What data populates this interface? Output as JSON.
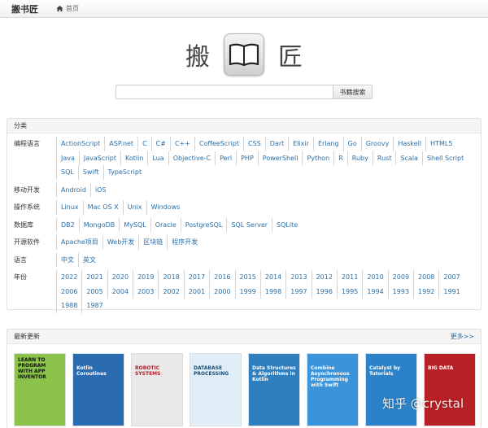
{
  "header": {
    "brand": "搬书匠",
    "home_label": "首页"
  },
  "hero": {
    "char_left": "搬",
    "char_right": "匠"
  },
  "search": {
    "placeholder": "",
    "button_label": "书籍搜索"
  },
  "categories": {
    "title": "分类",
    "rows": [
      {
        "label": "编程语言",
        "items": [
          "ActionScript",
          "ASP.net",
          "C",
          "C#",
          "C++",
          "CoffeeScript",
          "CSS",
          "Dart",
          "Elixir",
          "Erlang",
          "Go",
          "Groovy",
          "Haskell",
          "HTML5",
          "Java",
          "JavaScript",
          "Kotlin",
          "Lua",
          "Objective-C",
          "Perl",
          "PHP",
          "PowerShell",
          "Python",
          "R",
          "Ruby",
          "Rust",
          "Scala",
          "Shell Script",
          "SQL",
          "Swift",
          "TypeScript"
        ]
      },
      {
        "label": "移动开发",
        "items": [
          "Android",
          "iOS"
        ]
      },
      {
        "label": "操作系统",
        "items": [
          "Linux",
          "Mac OS X",
          "Unix",
          "Windows"
        ]
      },
      {
        "label": "数据库",
        "items": [
          "DB2",
          "MongoDB",
          "MySQL",
          "Oracle",
          "PostgreSQL",
          "SQL Server",
          "SQLite"
        ]
      },
      {
        "label": "开源软件",
        "items": [
          "Apache项目",
          "Web开发",
          "区块链",
          "程序开发"
        ]
      },
      {
        "label": "语言",
        "items": [
          "中文",
          "英文"
        ]
      },
      {
        "label": "年份",
        "items": [
          "2022",
          "2021",
          "2020",
          "2019",
          "2018",
          "2017",
          "2016",
          "2015",
          "2014",
          "2013",
          "2012",
          "2011",
          "2010",
          "2009",
          "2008",
          "2007",
          "2006",
          "2005",
          "2004",
          "2003",
          "2002",
          "2001",
          "2000",
          "1999",
          "1998",
          "1997",
          "1996",
          "1995",
          "1994",
          "1993",
          "1992",
          "1991",
          "1988",
          "1987"
        ]
      }
    ]
  },
  "latest": {
    "title": "最新更新",
    "more_label": "更多>>",
    "books": [
      {
        "title": "LEARN TO PROGRAM WITH APP INVENTOR",
        "bg": "#8bc34a",
        "fg": "#111111"
      },
      {
        "title": "Kotlin Coroutines",
        "bg": "#2b6cb0",
        "fg": "#ffffff"
      },
      {
        "title": "ROBOTIC SYSTEMS",
        "bg": "#e9e9e9",
        "fg": "#b51f2a"
      },
      {
        "title": "DATABASE PROCESSING",
        "bg": "#dfeef7",
        "fg": "#1c4f7a"
      },
      {
        "title": "Data Structures & Algorithms in Kotlin",
        "bg": "#2f7fbf",
        "fg": "#ffffff"
      },
      {
        "title": "Combine Asynchronous Programming with Swift",
        "bg": "#3b93d9",
        "fg": "#ffffff"
      },
      {
        "title": "Catalyst by Tutorials",
        "bg": "#2c82c9",
        "fg": "#ffffff"
      },
      {
        "title": "BIG DATA",
        "bg": "#b82025",
        "fg": "#ffffff"
      }
    ]
  },
  "watermark": "知乎 @crystal"
}
